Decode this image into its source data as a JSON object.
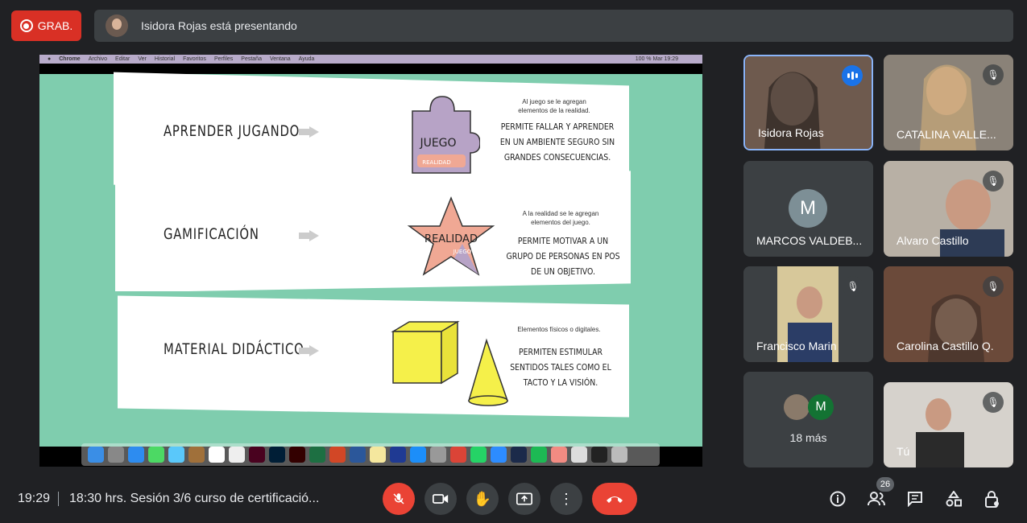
{
  "recording": {
    "label": "GRAB."
  },
  "presenter_bar": {
    "text": "Isidora Rojas está presentando"
  },
  "mac_menu": [
    "Chrome",
    "Archivo",
    "Editar",
    "Ver",
    "Historial",
    "Favoritos",
    "Perfiles",
    "Pestaña",
    "Ventana",
    "Ayuda"
  ],
  "mac_status": "100 %   Mar 19:29",
  "slide": {
    "row1": {
      "label": "APRENDER JUGANDO",
      "small": "Al juego se le agregan elementos de la realidad.",
      "big": "PERMITE FALLAR Y APRENDER EN UN AMBIENTE SEGURO SIN GRANDES CONSECUENCIAS.",
      "puzzle_word": "JUEGO",
      "puzzle_sub": "REALIDAD"
    },
    "row2": {
      "label": "GAMIFICACIÓN",
      "small": "A la realidad se le agregan elementos del juego.",
      "big": "PERMITE MOTIVAR A UN GRUPO DE PERSONAS EN POS DE UN OBJETIVO.",
      "star_word": "REALIDAD",
      "star_sub": "JUEGO"
    },
    "row3": {
      "label": "MATERIAL DIDÁCTICO",
      "small": "Elementos físicos o digitales.",
      "big": "PERMITEN ESTIMULAR SENTIDOS TALES COMO EL TACTO Y LA VISIÓN."
    }
  },
  "participants": [
    {
      "name": "Isidora Rojas",
      "speaking": true
    },
    {
      "name": "CATALINA VALLE...",
      "muted": true
    },
    {
      "name": "MARCOS VALDEB...",
      "initial": "M"
    },
    {
      "name": "Alvaro Castillo",
      "muted": true
    },
    {
      "name": "Francisco Marin",
      "muted": true
    },
    {
      "name": "Carolina Castillo Q.",
      "muted": true
    },
    {
      "name": "Tú",
      "muted": true
    }
  ],
  "more_tile": {
    "label": "18 más",
    "initial": "M"
  },
  "bottom": {
    "time": "19:29",
    "meeting": "18:30 hrs. Sesión 3/6 curso de certificació...",
    "people_count": "26"
  },
  "colors": {
    "accent_red": "#ea4335",
    "tile_bg": "#3c4043",
    "speaking_blue": "#1a73e8",
    "slide_green": "#7fcdae"
  }
}
